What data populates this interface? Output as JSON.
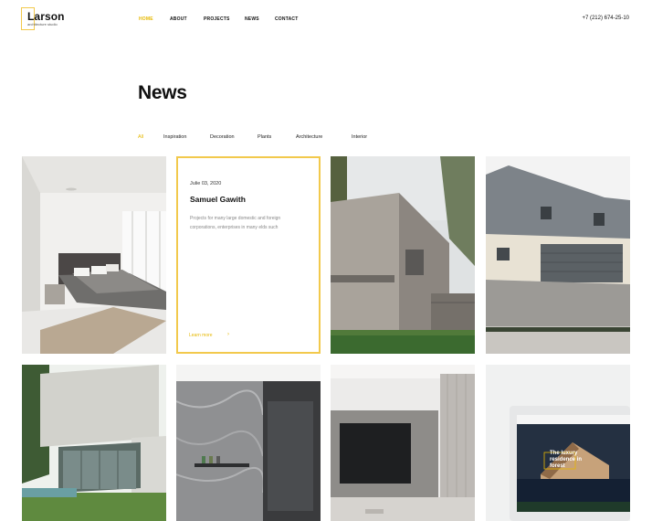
{
  "header": {
    "logo_name": "Larson",
    "logo_tagline": "architecture studio",
    "nav": [
      {
        "label": "HOME",
        "active": true
      },
      {
        "label": "ABOUT",
        "active": false
      },
      {
        "label": "PROJECTS",
        "active": false
      },
      {
        "label": "NEWS",
        "active": false
      },
      {
        "label": "CONTACT",
        "active": false
      }
    ],
    "phone": "+7 (212) 674-25-10"
  },
  "page": {
    "title": "News"
  },
  "filters": [
    {
      "label": "All",
      "active": true
    },
    {
      "label": "Inspiration",
      "active": false
    },
    {
      "label": "Decoration",
      "active": false
    },
    {
      "label": "Plants",
      "active": false
    },
    {
      "label": "Architecture",
      "active": false
    },
    {
      "label": "Interior",
      "active": false
    }
  ],
  "featured_post": {
    "date": "Julie 03, 2020",
    "author": "Samuel Gawith",
    "excerpt": "Projects for many large domestic and foreign corporations, enterprises in many elds such",
    "link": "Learn more",
    "link_arrow": "›"
  },
  "promo_screen": {
    "text": "The luxury residence in forest"
  },
  "colors": {
    "accent": "#f2c94c",
    "accent_text": "#e6b800",
    "text": "#111111",
    "muted": "#888888"
  }
}
